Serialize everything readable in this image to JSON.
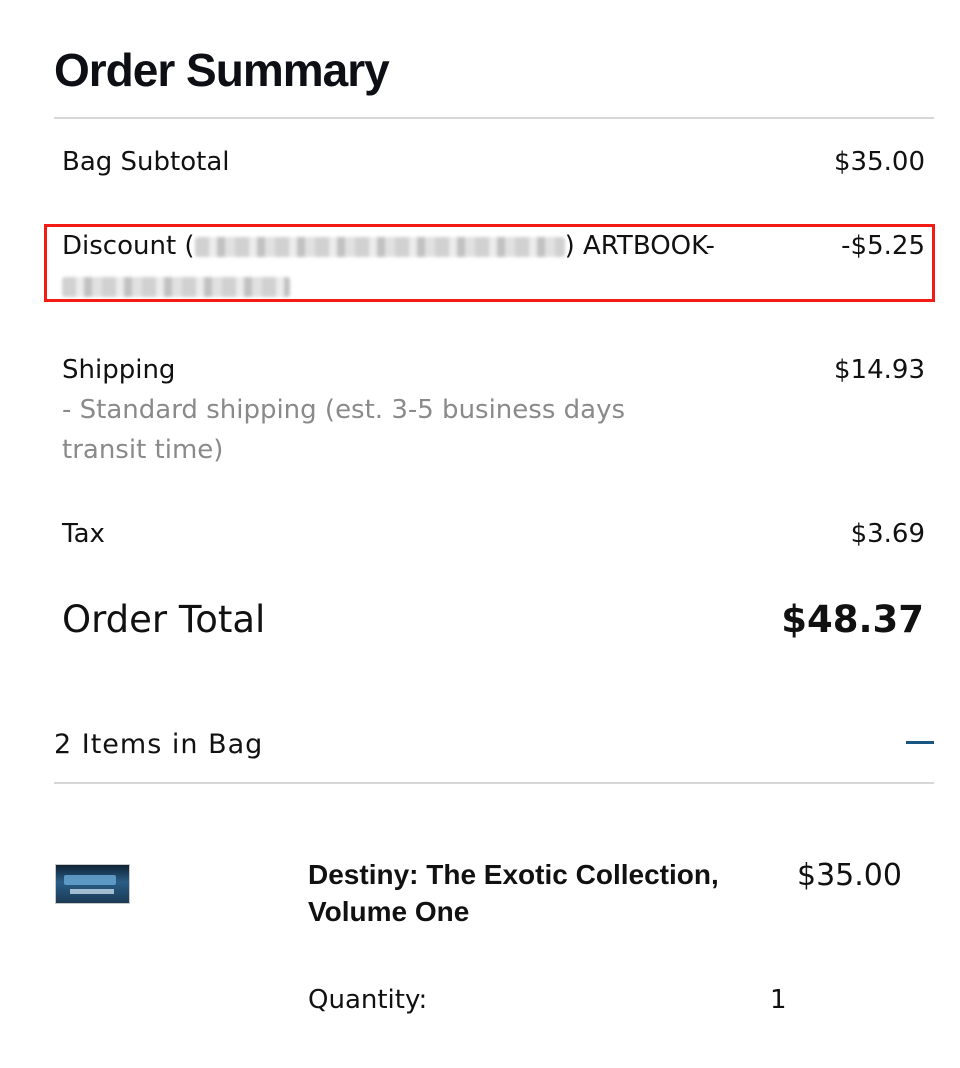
{
  "summary": {
    "title": "Order Summary",
    "bag_subtotal": {
      "label": "Bag Subtotal",
      "value": "$35.00"
    },
    "discount": {
      "label_prefix": "Discount (",
      "label_suffix": ") ARTBOOK-",
      "value": "-$5.25"
    },
    "shipping": {
      "label": "Shipping",
      "detail": "- Standard shipping (est. 3-5 business days transit time)",
      "value": "$14.93"
    },
    "tax": {
      "label": "Tax",
      "value": "$3.69"
    },
    "order_total": {
      "label": "Order Total",
      "value": "$48.37"
    }
  },
  "bag": {
    "items_label": "2 Items in Bag",
    "items": [
      {
        "name": "Destiny: The Exotic Collection, Volume One",
        "price": "$35.00",
        "quantity_label": "Quantity:",
        "quantity": "1"
      }
    ]
  },
  "colors": {
    "highlight": "#f21c14",
    "accent": "#1b5680",
    "muted": "#8a8a8a"
  }
}
